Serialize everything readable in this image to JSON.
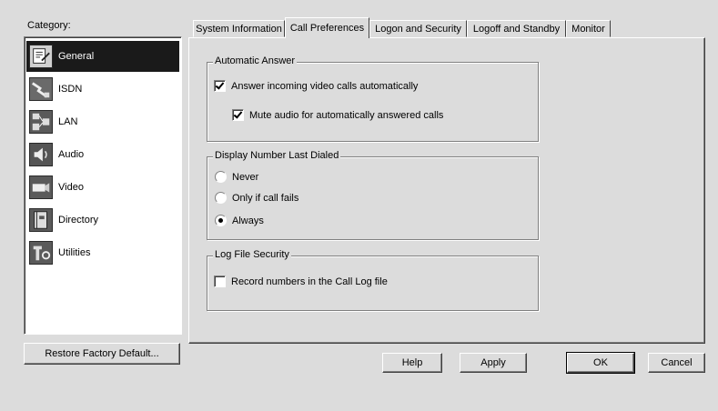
{
  "category": {
    "label": "Category:",
    "items": [
      {
        "label": "General",
        "icon": "general-icon",
        "selected": true
      },
      {
        "label": "ISDN",
        "icon": "isdn-icon"
      },
      {
        "label": "LAN",
        "icon": "lan-icon"
      },
      {
        "label": "Audio",
        "icon": "audio-icon"
      },
      {
        "label": "Video",
        "icon": "video-icon"
      },
      {
        "label": "Directory",
        "icon": "directory-icon"
      },
      {
        "label": "Utilities",
        "icon": "utilities-icon"
      }
    ]
  },
  "restore_button": "Restore Factory Default...",
  "tabs": [
    {
      "label": "System Information"
    },
    {
      "label": "Call Preferences",
      "active": true
    },
    {
      "label": "Logon and Security"
    },
    {
      "label": "Logoff and Standby"
    },
    {
      "label": "Monitor"
    }
  ],
  "groups": {
    "automatic_answer": {
      "title": "Automatic Answer",
      "answer_label": "Answer incoming video calls automatically",
      "answer_checked": true,
      "mute_label": "Mute audio for automatically answered calls",
      "mute_checked": true
    },
    "display_number": {
      "title": "Display Number Last Dialed",
      "options": [
        "Never",
        "Only if call fails",
        "Always"
      ],
      "selected": "Always"
    },
    "log_file": {
      "title": "Log File Security",
      "record_label": "Record numbers in the Call Log file",
      "record_checked": false
    }
  },
  "buttons": {
    "help": "Help",
    "apply": "Apply",
    "ok": "OK",
    "cancel": "Cancel"
  }
}
